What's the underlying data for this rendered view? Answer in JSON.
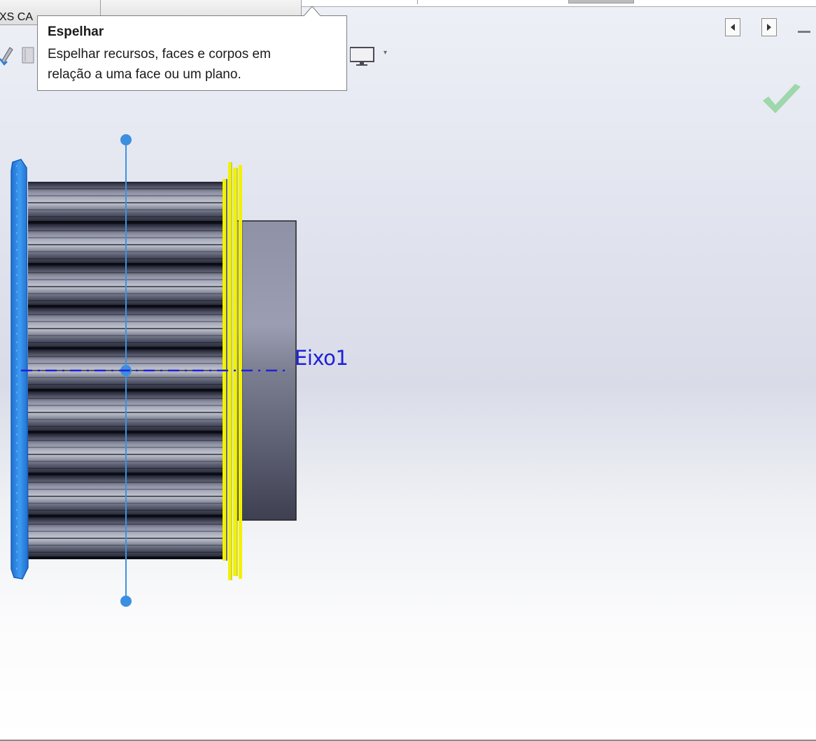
{
  "tabs": [
    {
      "label": "XS CA"
    },
    {
      "label": "",
      "dropdown_icon": "chevron-down-icon"
    }
  ],
  "tooltip": {
    "title": "Espelhar",
    "line1": "Espelhar recursos, faces e corpos em",
    "line2": "relação a uma face ou um plano."
  },
  "viewport": {
    "axis_label": "Eixo1",
    "confirm_icon": "check-icon"
  },
  "toolbar": {
    "display_dropdown": "▾"
  },
  "colors": {
    "selection_blue": "#2f8fe8",
    "highlight_yellow": "#f2f200",
    "axis_blue": "#2020d8",
    "confirm_green": "#8fd39d"
  }
}
